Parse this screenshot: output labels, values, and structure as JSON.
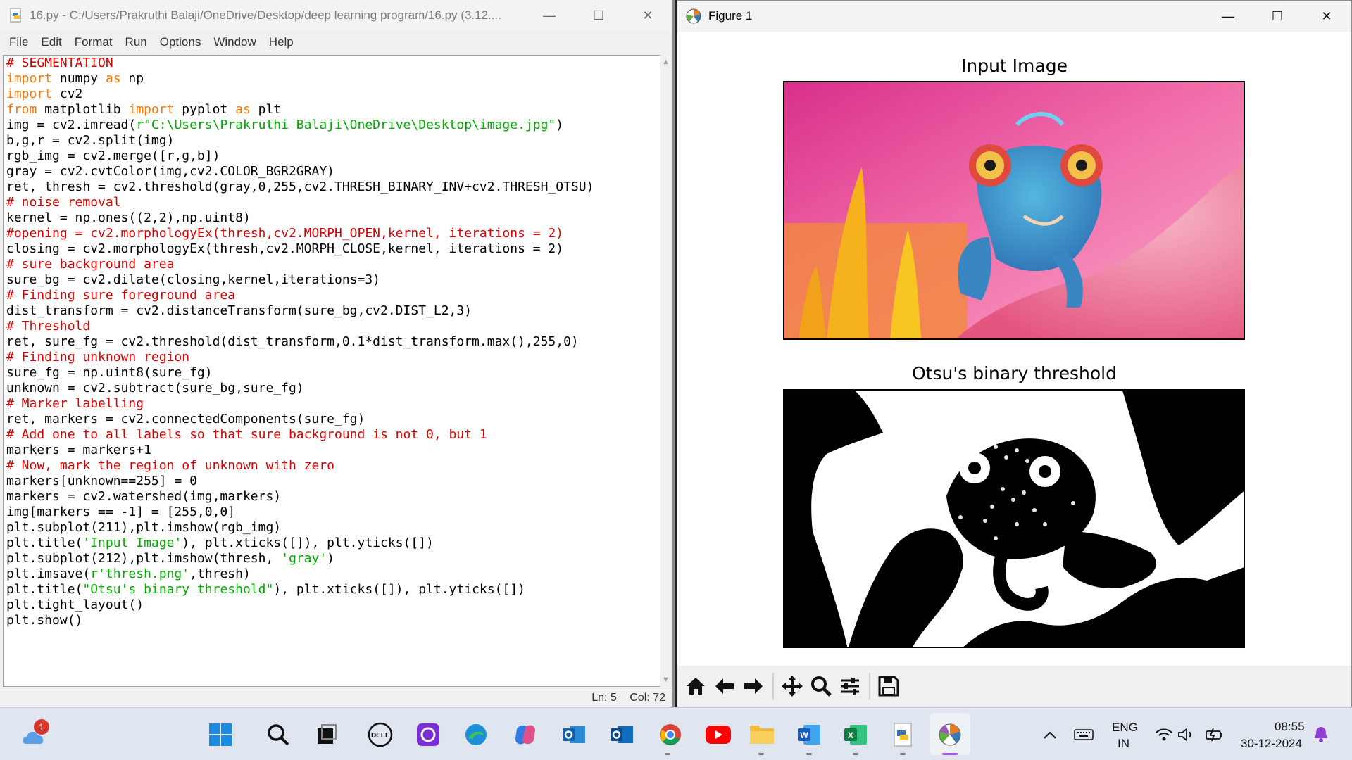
{
  "idle": {
    "title": "16.py - C:/Users/Prakruthi Balaji/OneDrive/Desktop/deep learning program/16.py (3.12....",
    "menu": [
      "File",
      "Edit",
      "Format",
      "Run",
      "Options",
      "Window",
      "Help"
    ],
    "status": {
      "line": "Ln: 5",
      "col": "Col: 72"
    },
    "code_lines": [
      [
        [
          "cm",
          "# SEGMENTATION"
        ]
      ],
      [
        [
          "kw",
          "import"
        ],
        [
          "",
          " numpy "
        ],
        [
          "kw",
          "as"
        ],
        [
          "",
          " np"
        ]
      ],
      [
        [
          "kw",
          "import"
        ],
        [
          "",
          " cv2"
        ]
      ],
      [
        [
          "kw",
          "from"
        ],
        [
          "",
          " matplotlib "
        ],
        [
          "kw",
          "import"
        ],
        [
          "",
          " pyplot "
        ],
        [
          "kw",
          "as"
        ],
        [
          "",
          " plt"
        ]
      ],
      [
        [
          "",
          "img = cv2.imread("
        ],
        [
          "st",
          "r\"C:\\Users\\Prakruthi Balaji\\OneDrive\\Desktop\\image.jpg\""
        ],
        [
          "",
          ")"
        ]
      ],
      [
        [
          "",
          "b,g,r = cv2.split(img)"
        ]
      ],
      [
        [
          "",
          "rgb_img = cv2.merge([r,g,b])"
        ]
      ],
      [
        [
          "",
          "gray = cv2.cvtColor(img,cv2.COLOR_BGR2GRAY)"
        ]
      ],
      [
        [
          "",
          "ret, thresh = cv2.threshold(gray,0,255,cv2.THRESH_BINARY_INV+cv2.THRESH_OTSU)"
        ]
      ],
      [
        [
          "cm",
          "# noise removal"
        ]
      ],
      [
        [
          "",
          "kernel = np.ones((2,2),np.uint8)"
        ]
      ],
      [
        [
          "cm",
          "#opening = cv2.morphologyEx(thresh,cv2.MORPH_OPEN,kernel, iterations = 2)"
        ]
      ],
      [
        [
          "",
          "closing = cv2.morphologyEx(thresh,cv2.MORPH_CLOSE,kernel, iterations = 2)"
        ]
      ],
      [
        [
          "cm",
          "# sure background area"
        ]
      ],
      [
        [
          "",
          "sure_bg = cv2.dilate(closing,kernel,iterations=3)"
        ]
      ],
      [
        [
          "cm",
          "# Finding sure foreground area"
        ]
      ],
      [
        [
          "",
          "dist_transform = cv2.distanceTransform(sure_bg,cv2.DIST_L2,3)"
        ]
      ],
      [
        [
          "cm",
          "# Threshold"
        ]
      ],
      [
        [
          "",
          "ret, sure_fg = cv2.threshold(dist_transform,0.1*dist_transform.max(),255,0)"
        ]
      ],
      [
        [
          "cm",
          "# Finding unknown region"
        ]
      ],
      [
        [
          "",
          "sure_fg = np.uint8(sure_fg)"
        ]
      ],
      [
        [
          "",
          "unknown = cv2.subtract(sure_bg,sure_fg)"
        ]
      ],
      [
        [
          "cm",
          "# Marker labelling"
        ]
      ],
      [
        [
          "",
          "ret, markers = cv2.connectedComponents(sure_fg)"
        ]
      ],
      [
        [
          "cm",
          "# Add one to all labels so that sure background is not 0, but 1"
        ]
      ],
      [
        [
          "",
          "markers = markers+1"
        ]
      ],
      [
        [
          "cm",
          "# Now, mark the region of unknown with zero"
        ]
      ],
      [
        [
          "",
          "markers[unknown==255] = 0"
        ]
      ],
      [
        [
          "",
          "markers = cv2.watershed(img,markers)"
        ]
      ],
      [
        [
          "",
          "img[markers == -1] = [255,0,0]"
        ]
      ],
      [
        [
          "",
          "plt.subplot(211),plt.imshow(rgb_img)"
        ]
      ],
      [
        [
          "",
          "plt.title("
        ],
        [
          "st",
          "'Input Image'"
        ],
        [
          "",
          "), plt.xticks([]), plt.yticks([])"
        ]
      ],
      [
        [
          "",
          "plt.subplot(212),plt.imshow(thresh, "
        ],
        [
          "st",
          "'gray'"
        ],
        [
          "",
          ")"
        ]
      ],
      [
        [
          "",
          "plt.imsave("
        ],
        [
          "st",
          "r'thresh.png'"
        ],
        [
          "",
          ",thresh)"
        ]
      ],
      [
        [
          "",
          "plt.title("
        ],
        [
          "st",
          "\"Otsu's binary threshold\""
        ],
        [
          "",
          "), plt.xticks([]), plt.yticks([])"
        ]
      ],
      [
        [
          "",
          "plt.tight_layout()"
        ]
      ],
      [
        [
          "",
          "plt.show()"
        ]
      ]
    ]
  },
  "figure": {
    "window_title": "Figure 1",
    "subplot1_title": "Input Image",
    "subplot2_title": "Otsu's binary threshold",
    "toolbar": [
      "home-icon",
      "back-arrow-icon",
      "forward-arrow-icon",
      "pan-icon",
      "zoom-icon",
      "subplots-config-icon",
      "save-icon"
    ]
  },
  "taskbar": {
    "weather_badge": "1",
    "apps": [
      "start",
      "search",
      "task-view",
      "dell",
      "alexa",
      "edge",
      "copilot",
      "outlook",
      "outlook-new",
      "chrome",
      "youtube",
      "file-explorer",
      "word",
      "excel",
      "python-idle",
      "matplotlib-figure"
    ],
    "language": "ENG",
    "region": "IN",
    "time": "08:55",
    "date": "30-12-2024"
  },
  "colors": {
    "keyword": "#ff7700",
    "comment": "#dd0000",
    "string": "#00aa00",
    "taskbar": "#dfe6ef"
  }
}
